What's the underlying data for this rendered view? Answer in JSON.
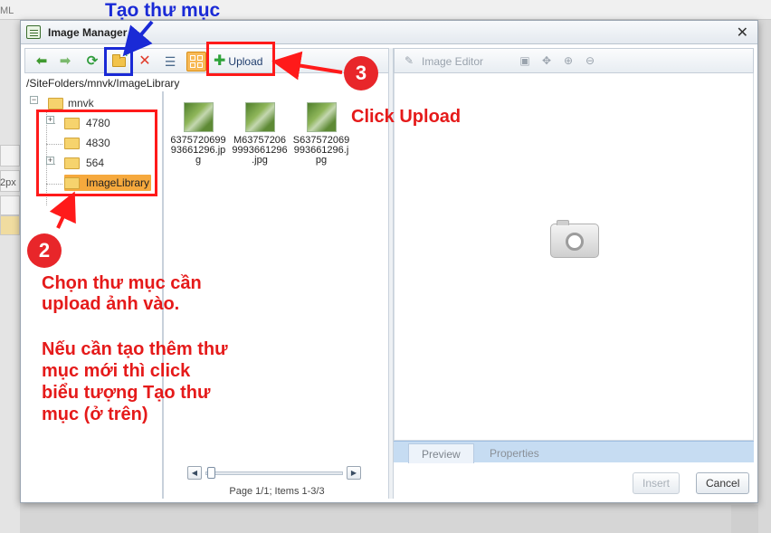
{
  "background": {
    "ml_text": "ML",
    "px_text": "2px"
  },
  "dialog": {
    "title": "Image Manager",
    "close_icon": "close-icon"
  },
  "toolbar": {
    "upload_label": "Upload"
  },
  "path": "/SiteFolders/mnvk/ImageLibrary",
  "tree": {
    "root": "mnvk",
    "children": [
      "4780",
      "4830",
      "564",
      "ImageLibrary"
    ],
    "selected": "ImageLibrary"
  },
  "files": [
    {
      "name_lines": [
        "6375720699",
        "93661296.jp",
        "g"
      ]
    },
    {
      "name_lines": [
        "M63757206",
        "9993661296",
        ".jpg"
      ]
    },
    {
      "name_lines": [
        "S637572069",
        "993661296.j",
        "pg"
      ]
    }
  ],
  "pager": {
    "text": "Page 1/1; Items 1-3/3"
  },
  "editor": {
    "label": "Image Editor"
  },
  "tabs": [
    "Preview",
    "Properties"
  ],
  "buttons": {
    "insert": "Insert",
    "cancel": "Cancel"
  },
  "annotations": {
    "tao_thu_muc": "Tạo thư mục",
    "step2": "2",
    "step3": "3",
    "click_upload": "Click Upload",
    "chon_lines": [
      "Chọn thư mục cần",
      "upload ảnh vào."
    ],
    "neu_lines": [
      "Nếu cần tạo thêm thư",
      "mục mới thì click",
      "biểu tượng Tạo thư",
      "mục (ở trên)"
    ]
  },
  "colors": {
    "annotation_red": "#e51a1a",
    "annotation_blue": "#1a2ad6",
    "selected_folder": "#f6a93d"
  }
}
